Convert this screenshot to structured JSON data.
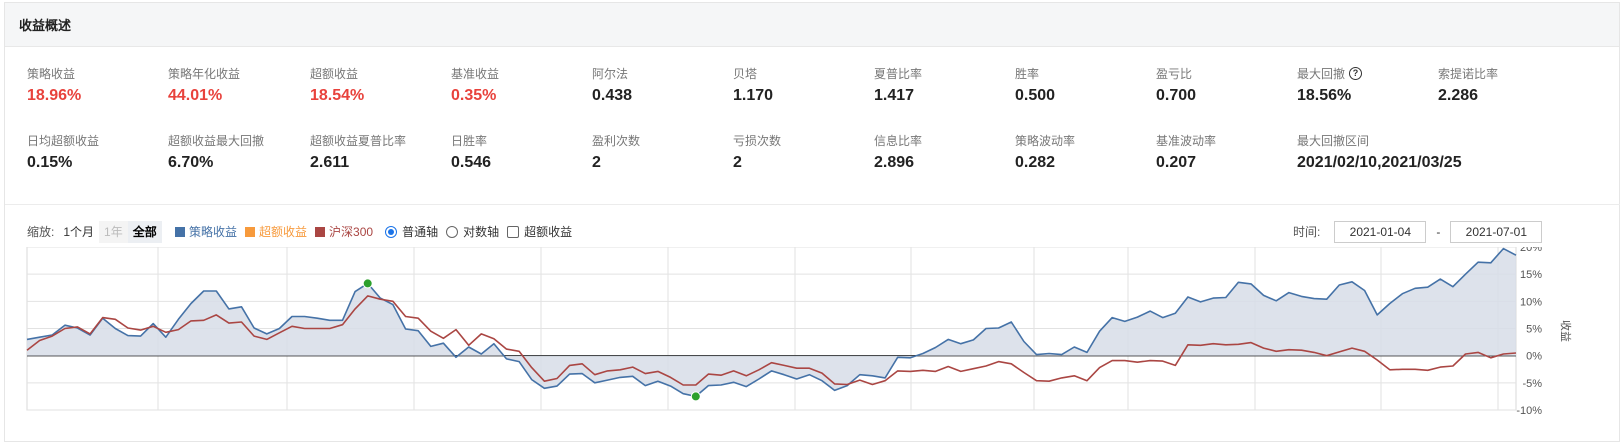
{
  "panel": {
    "title": "收益概述"
  },
  "metrics": [
    {
      "label": "策略收益",
      "value": "18.96%",
      "highlight": true
    },
    {
      "label": "策略年化收益",
      "value": "44.01%",
      "highlight": true
    },
    {
      "label": "超额收益",
      "value": "18.54%",
      "highlight": true
    },
    {
      "label": "基准收益",
      "value": "0.35%",
      "highlight": true
    },
    {
      "label": "阿尔法",
      "value": "0.438",
      "highlight": false
    },
    {
      "label": "贝塔",
      "value": "1.170",
      "highlight": false
    },
    {
      "label": "夏普比率",
      "value": "1.417",
      "highlight": false
    },
    {
      "label": "胜率",
      "value": "0.500",
      "highlight": false
    },
    {
      "label": "盈亏比",
      "value": "0.700",
      "highlight": false
    },
    {
      "label": "最大回撤",
      "value": "18.56%",
      "highlight": false,
      "help_icon": "?"
    },
    {
      "label": "索提诺比率",
      "value": "2.286",
      "highlight": false
    },
    {
      "label": "日均超额收益",
      "value": "0.15%",
      "highlight": false
    },
    {
      "label": "超额收益最大回撤",
      "value": "6.70%",
      "highlight": false
    },
    {
      "label": "超额收益夏普比率",
      "value": "2.611",
      "highlight": false
    },
    {
      "label": "日胜率",
      "value": "0.546",
      "highlight": false
    },
    {
      "label": "盈利次数",
      "value": "2",
      "highlight": false
    },
    {
      "label": "亏损次数",
      "value": "2",
      "highlight": false
    },
    {
      "label": "信息比率",
      "value": "2.896",
      "highlight": false
    },
    {
      "label": "策略波动率",
      "value": "0.282",
      "highlight": false
    },
    {
      "label": "基准波动率",
      "value": "0.207",
      "highlight": false
    },
    {
      "label": "最大回撤区间",
      "value": "2021/02/10,2021/03/25",
      "highlight": false
    }
  ],
  "toolbar": {
    "zoom_label": "缩放:",
    "zoom_options": [
      "1个月",
      "1年",
      "全部"
    ],
    "legend": [
      {
        "name": "策略收益",
        "color": "#4572a7"
      },
      {
        "name": "超额收益",
        "color": "#f79a3c"
      },
      {
        "name": "沪深300",
        "color": "#aa4643"
      }
    ],
    "axis_options": [
      "普通轴",
      "对数轴"
    ],
    "axis_selected": "普通轴",
    "excess_checkbox": "超额收益",
    "time_label": "时间:",
    "date_from": "2021-01-04",
    "date_separator": "-",
    "date_to": "2021-07-01"
  },
  "colors": {
    "red": "#e8423c",
    "strategy": "#4572a7",
    "benchmark": "#aa4643",
    "fill": "#d7dde8",
    "marker": "#2ca02c"
  },
  "chart_data": {
    "type": "line",
    "ylabel": "收益",
    "y_ticks": [
      "20%",
      "15%",
      "10%",
      "5%",
      "0%",
      "-5%",
      "-10%"
    ],
    "ylim": [
      -10,
      20
    ],
    "grid": true,
    "series": [
      {
        "name": "策略收益",
        "color": "#4572a7",
        "fill": true,
        "values": [
          3.0,
          3.4,
          3.8,
          5.6,
          5.1,
          3.8,
          6.9,
          5.0,
          3.7,
          3.6,
          5.9,
          3.4,
          6.7,
          9.6,
          11.9,
          11.9,
          8.6,
          9.0,
          5.1,
          4.0,
          5.0,
          7.2,
          7.2,
          6.9,
          6.5,
          6.5,
          11.8,
          13.3,
          10.6,
          9.4,
          4.9,
          4.6,
          1.7,
          2.3,
          -0.3,
          1.6,
          0.3,
          2.2,
          -0.6,
          -1.1,
          -4.4,
          -6.0,
          -5.6,
          -3.4,
          -3.3,
          -5.0,
          -4.5,
          -4.0,
          -3.8,
          -5.5,
          -4.7,
          -5.6,
          -7.0,
          -7.5,
          -5.5,
          -5.4,
          -4.9,
          -5.7,
          -4.3,
          -2.8,
          -3.5,
          -4.3,
          -3.5,
          -4.6,
          -6.4,
          -5.5,
          -3.5,
          -3.7,
          -4.1,
          -0.3,
          -0.4,
          0.4,
          1.5,
          3.0,
          2.2,
          2.9,
          5.0,
          5.1,
          6.2,
          2.6,
          0.2,
          0.4,
          0.2,
          1.6,
          0.6,
          4.5,
          7.0,
          6.3,
          7.1,
          8.2,
          7.0,
          7.8,
          10.8,
          9.9,
          10.6,
          10.7,
          13.5,
          13.2,
          11.1,
          10.1,
          11.6,
          10.9,
          10.5,
          10.4,
          13.0,
          13.6,
          12.0,
          7.5,
          9.6,
          11.4,
          12.4,
          12.6,
          14.1,
          12.7,
          15.0,
          17.2,
          17.1,
          19.7,
          18.5
        ]
      },
      {
        "name": "沪深300",
        "color": "#aa4643",
        "fill": false,
        "values": [
          1.0,
          2.8,
          3.6,
          5.0,
          5.3,
          4.0,
          7.0,
          6.7,
          5.1,
          4.7,
          5.4,
          4.3,
          4.8,
          6.4,
          6.5,
          7.5,
          6.0,
          6.2,
          3.6,
          3.0,
          4.2,
          5.4,
          5.0,
          5.0,
          5.0,
          5.7,
          8.6,
          11.0,
          10.4,
          10.0,
          7.2,
          6.9,
          4.5,
          3.2,
          4.8,
          1.9,
          4.0,
          3.1,
          1.2,
          0.8,
          -2.2,
          -4.7,
          -4.2,
          -1.8,
          -1.5,
          -3.5,
          -2.8,
          -2.6,
          -2.1,
          -3.3,
          -2.9,
          -4.0,
          -5.4,
          -5.4,
          -3.4,
          -3.6,
          -2.8,
          -3.7,
          -2.6,
          -1.3,
          -1.8,
          -2.3,
          -2.3,
          -3.2,
          -5.2,
          -5.3,
          -4.5,
          -5.3,
          -4.6,
          -2.8,
          -2.9,
          -2.7,
          -2.9,
          -2.0,
          -2.9,
          -2.4,
          -1.9,
          -1.1,
          -1.5,
          -3.1,
          -4.6,
          -4.7,
          -4.1,
          -3.7,
          -4.6,
          -2.2,
          -0.9,
          -0.9,
          -1.2,
          -0.9,
          -1.0,
          -1.8,
          2.0,
          1.9,
          2.2,
          2.0,
          2.1,
          2.4,
          1.4,
          0.8,
          1.1,
          1.0,
          0.6,
          0.0,
          0.7,
          1.4,
          0.8,
          -0.8,
          -2.6,
          -2.5,
          -2.5,
          -2.7,
          -2.1,
          -1.9,
          0.3,
          0.6,
          -0.4,
          0.3,
          0.5
        ]
      }
    ],
    "markers": [
      {
        "series": "策略收益",
        "index": 27,
        "value": 13.3
      },
      {
        "series": "策略收益",
        "index": 53,
        "value": -7.5
      }
    ]
  }
}
